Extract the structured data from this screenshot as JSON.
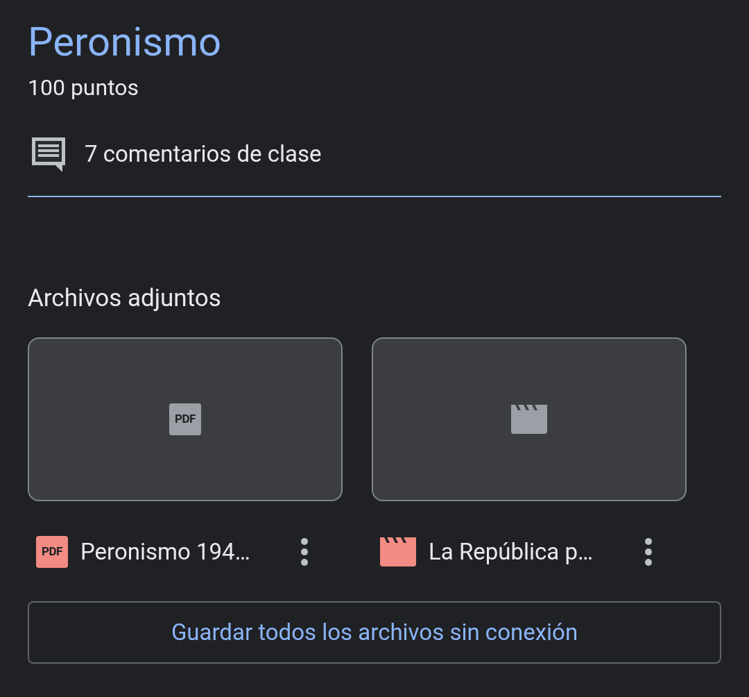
{
  "title": "Peronismo",
  "points": "100 puntos",
  "comments": {
    "label": "7 comentarios de clase"
  },
  "attachments_heading": "Archivos adjuntos",
  "attachments": [
    {
      "kind": "pdf",
      "thumbnail_icon_text": "PDF",
      "icon_text": "PDF",
      "name": "Peronismo 194…"
    },
    {
      "kind": "video",
      "name": "La República p…"
    }
  ],
  "save_button": "Guardar todos los archivos sin conexión"
}
